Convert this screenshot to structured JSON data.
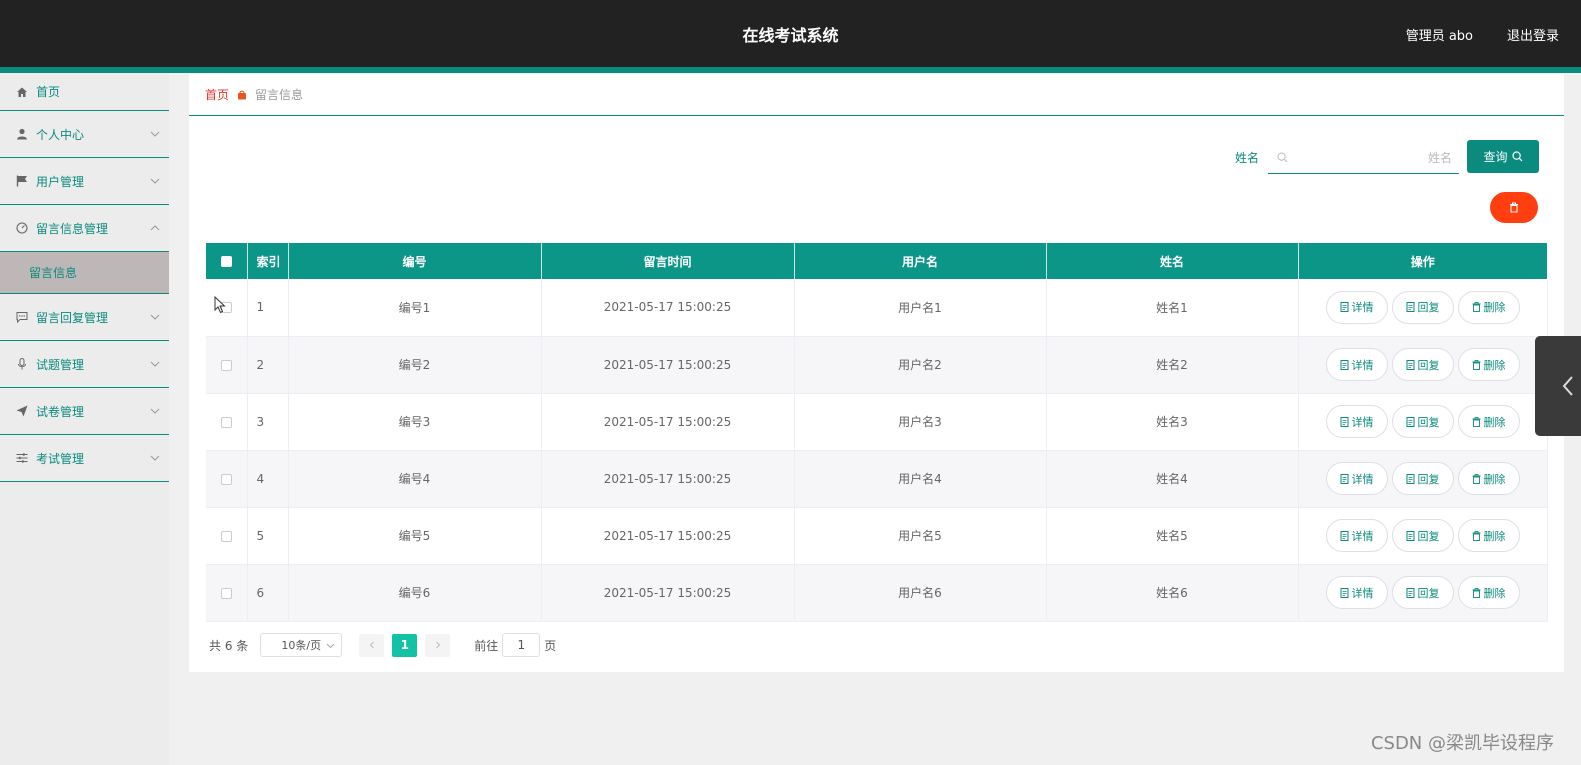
{
  "header": {
    "app_title": "在线考试系统",
    "user_label": "管理员 abo",
    "logout_label": "退出登录",
    "accent_color": "#0b8a7e",
    "bg_color": "#222222"
  },
  "sidebar": {
    "items": [
      {
        "label": "首页",
        "icon": "home-icon"
      },
      {
        "label": "个人中心",
        "icon": "user-icon"
      },
      {
        "label": "用户管理",
        "icon": "flag-icon"
      },
      {
        "label": "留言信息管理",
        "icon": "gauge-icon",
        "expanded": true
      },
      {
        "label": "留言回复管理",
        "icon": "chat-icon"
      },
      {
        "label": "试题管理",
        "icon": "mic-icon"
      },
      {
        "label": "试卷管理",
        "icon": "send-icon"
      },
      {
        "label": "考试管理",
        "icon": "sliders-icon"
      }
    ],
    "submenu_active": "留言信息"
  },
  "breadcrumb": {
    "home": "首页",
    "current": "留言信息"
  },
  "search": {
    "label": "姓名",
    "placeholder": "姓名",
    "value": "",
    "query_label": "查询"
  },
  "table": {
    "headers": [
      "索引",
      "编号",
      "留言时间",
      "用户名",
      "姓名",
      "操作"
    ],
    "rows": [
      {
        "index": "1",
        "code": "编号1",
        "time": "2021-05-17 15:00:25",
        "username": "用户名1",
        "name": "姓名1"
      },
      {
        "index": "2",
        "code": "编号2",
        "time": "2021-05-17 15:00:25",
        "username": "用户名2",
        "name": "姓名2"
      },
      {
        "index": "3",
        "code": "编号3",
        "time": "2021-05-17 15:00:25",
        "username": "用户名3",
        "name": "姓名3"
      },
      {
        "index": "4",
        "code": "编号4",
        "time": "2021-05-17 15:00:25",
        "username": "用户名4",
        "name": "姓名4"
      },
      {
        "index": "5",
        "code": "编号5",
        "time": "2021-05-17 15:00:25",
        "username": "用户名5",
        "name": "姓名5"
      },
      {
        "index": "6",
        "code": "编号6",
        "time": "2021-05-17 15:00:25",
        "username": "用户名6",
        "name": "姓名6"
      }
    ],
    "actions": {
      "detail": "详情",
      "reply": "回复",
      "delete": "删除"
    }
  },
  "pagination": {
    "total_text": "共 6 条",
    "page_size": "10条/页",
    "current_page": "1",
    "goto_label": "前往",
    "goto_value": "1",
    "page_unit": "页"
  },
  "watermark": "CSDN @梁凯毕设程序"
}
